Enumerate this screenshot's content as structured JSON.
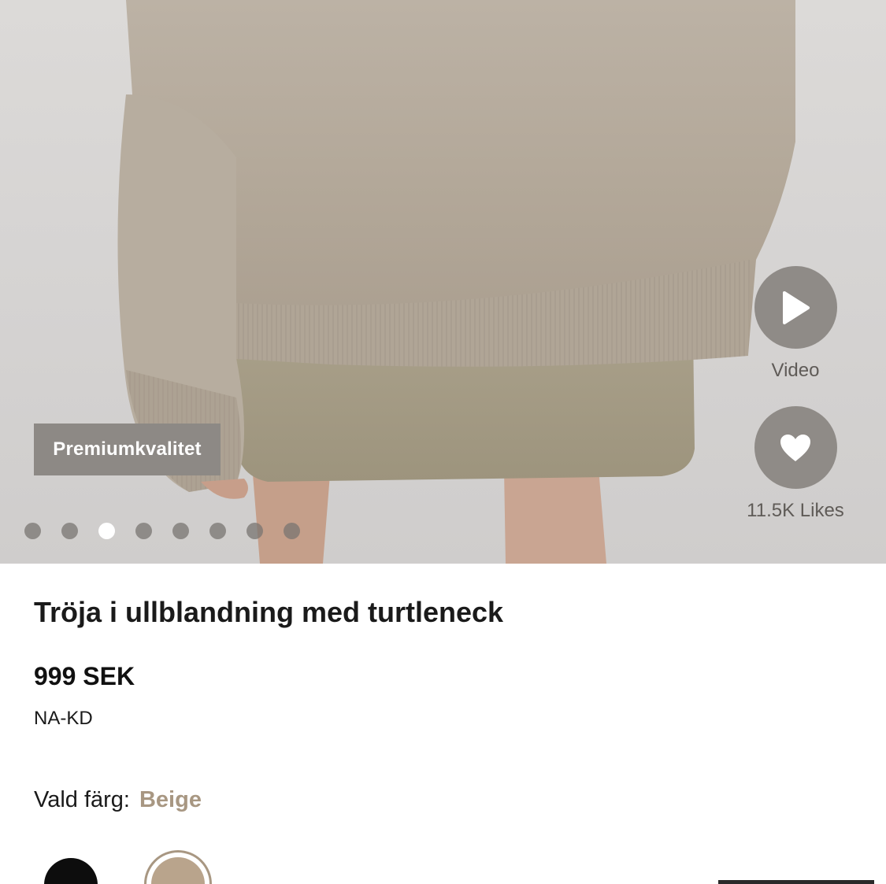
{
  "hero": {
    "badge": "Premiumkvalitet",
    "carousel": {
      "total": 8,
      "active_index": 2
    },
    "video_label": "Video",
    "likes_label": "11.5K Likes",
    "icons": {
      "video": "play-icon",
      "likes": "heart-icon"
    }
  },
  "product": {
    "title": "Tröja i ullblandning med turtleneck",
    "price": "999 SEK",
    "brand": "NA-KD",
    "color_label": "Vald färg:",
    "color_value": "Beige"
  },
  "swatches": [
    {
      "name": "Black",
      "color": "#0d0d0d",
      "selected": false
    },
    {
      "name": "Beige",
      "color": "#b9a48c",
      "selected": true
    }
  ],
  "colors": {
    "accent": "#a89782",
    "badge_bg": "#8d8985",
    "button_bg": "#8f8b87"
  }
}
